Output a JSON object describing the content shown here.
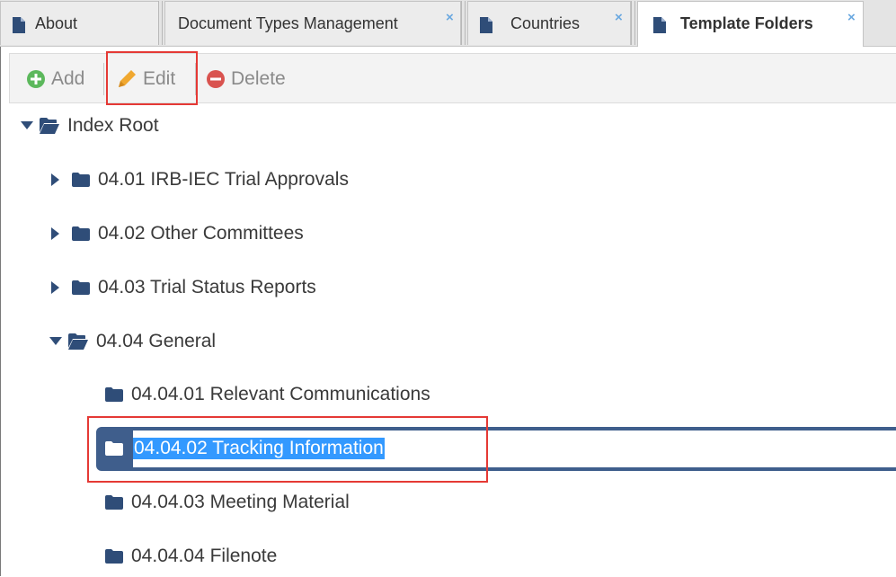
{
  "tabs": [
    {
      "label": "About",
      "closable": false,
      "active": false,
      "icon": "document-icon"
    },
    {
      "label": "Document Types Management",
      "closable": true,
      "active": false
    },
    {
      "label": "Countries",
      "closable": true,
      "active": false,
      "icon": "document-icon"
    },
    {
      "label": "Template Folders",
      "closable": true,
      "active": true,
      "icon": "document-icon"
    }
  ],
  "close_glyph": "×",
  "toolbar": {
    "add_label": "Add",
    "edit_label": "Edit",
    "delete_label": "Delete"
  },
  "tree": {
    "root": {
      "label": "Index Root",
      "expanded": true
    },
    "items": [
      {
        "label": "04.01 IRB-IEC Trial Approvals",
        "expanded": false
      },
      {
        "label": "04.02 Other Committees",
        "expanded": false
      },
      {
        "label": "04.03 Trial Status Reports",
        "expanded": false
      },
      {
        "label": "04.04 General",
        "expanded": true,
        "children": [
          {
            "label": "04.04.01 Relevant Communications"
          },
          {
            "label": "04.04.02 Tracking Information",
            "selected": true
          },
          {
            "label": "04.04.03 Meeting Material"
          },
          {
            "label": "04.04.04 Filenote"
          }
        ]
      }
    ]
  },
  "colors": {
    "add_icon": "#5cb85c",
    "edit_icon": "#f0a830",
    "delete_icon": "#d9534f",
    "tree_icon": "#2f4d78",
    "selection_bar": "#3f5e8c",
    "text_selection": "#3399ff",
    "annotation_box": "#e53935",
    "tab_close": "#6aa8e0"
  }
}
